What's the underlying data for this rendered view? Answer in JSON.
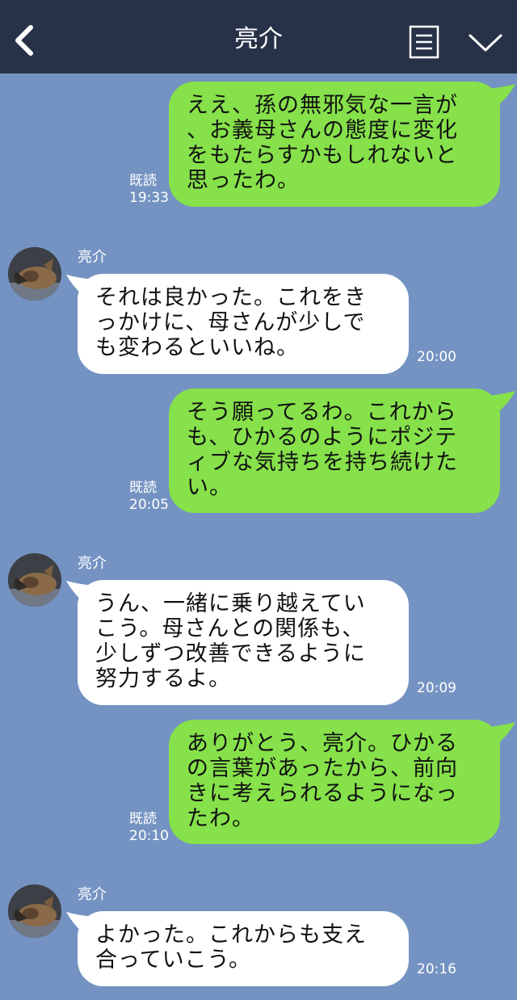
{
  "header": {
    "title": "亮介",
    "back_icon": "chevron-left-icon",
    "menu_icon": "list-icon",
    "expand_icon": "chevron-down-icon",
    "background": "#273248"
  },
  "colors": {
    "background": "#7493c2",
    "my_bubble": "#86e14a",
    "their_bubble": "#ffffff"
  },
  "messages": [
    {
      "sender": "me",
      "text": "ええ、孫の無邪気な一言が\n、お義母さんの態度に変化\nをもたらすかもしれないと\n思ったわ。",
      "read": "既読",
      "time": "19:33"
    },
    {
      "sender": "亮介",
      "name": "亮介",
      "text": "それは良かった。これをき\nっかけに、母さんが少しで\nも変わるといいね。",
      "time": "20:00"
    },
    {
      "sender": "me",
      "text": "そう願ってるわ。これから\nも、ひかるのようにポジテ\nィブな気持ちを持ち続けた\nい。",
      "read": "既読",
      "time": "20:05"
    },
    {
      "sender": "亮介",
      "name": "亮介",
      "text": "うん、一緒に乗り越えてい\nこう。母さんとの関係も、\n少しずつ改善できるように\n努力するよ。",
      "time": "20:09"
    },
    {
      "sender": "me",
      "text": "ありがとう、亮介。ひかる\nの言葉があったから、前向\nきに考えられるようになっ\nたわ。",
      "read": "既読",
      "time": "20:10"
    },
    {
      "sender": "亮介",
      "name": "亮介",
      "text": "よかった。これからも支え\n合っていこう。",
      "time": "20:16"
    }
  ]
}
